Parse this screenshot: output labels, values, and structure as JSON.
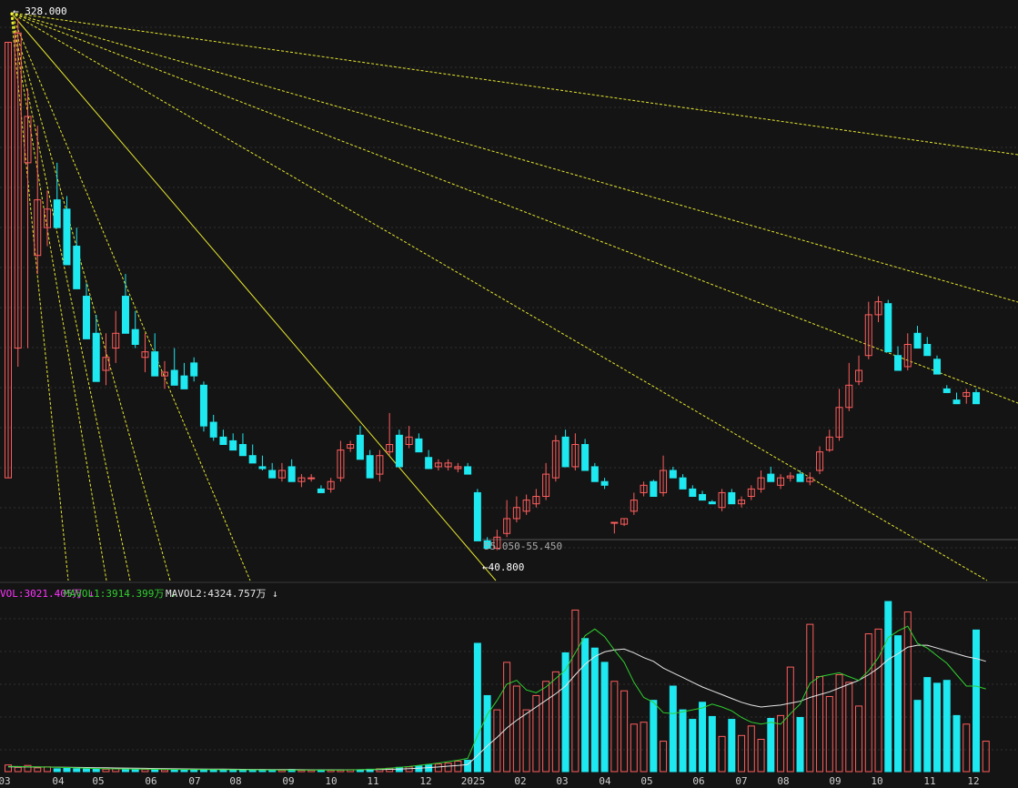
{
  "colors": {
    "background": "#141414",
    "up": "#ff5d5d",
    "down": "#1ee8f0",
    "fan": "#ffff33",
    "mavol1": "#2fd02f",
    "mavol2": "#e6e6e6",
    "vol_label": "#ff33ff",
    "grid": "#2f2f2f"
  },
  "chart_data": [
    {
      "type": "candlestick",
      "title": "",
      "high_label": "328.000",
      "low_label": "40.800",
      "range_label": "55.050-55.450",
      "ylim": [
        40,
        330
      ],
      "grid": true,
      "month_labels": [
        "03",
        "04",
        "05",
        "06",
        "07",
        "08",
        "09",
        "10",
        "11",
        "12",
        "2025",
        "02",
        "03",
        "04",
        "05",
        "06",
        "07",
        "08",
        "09",
        "10",
        "11",
        "12"
      ],
      "candles": [
        [
          80,
          80,
          315,
          315
        ],
        [
          150,
          140,
          320,
          328
        ],
        [
          250,
          150,
          275,
          290
        ],
        [
          200,
          190,
          230,
          270
        ],
        [
          215,
          205,
          225,
          235
        ],
        [
          230,
          220,
          215,
          250
        ],
        [
          225,
          215,
          195,
          232
        ],
        [
          205,
          195,
          182,
          215
        ],
        [
          178,
          168,
          155,
          185
        ],
        [
          158,
          140,
          132,
          168
        ],
        [
          138,
          130,
          145,
          158
        ],
        [
          150,
          142,
          158,
          170
        ],
        [
          178,
          168,
          158,
          190
        ],
        [
          160,
          150,
          152,
          170
        ],
        [
          145,
          137,
          148,
          158
        ],
        [
          148,
          140,
          135,
          158
        ],
        [
          135,
          128,
          137,
          143
        ],
        [
          138,
          132,
          130,
          150
        ],
        [
          135,
          128,
          128,
          142
        ],
        [
          142,
          132,
          135,
          145
        ],
        [
          130,
          105,
          108,
          132
        ],
        [
          110,
          100,
          102,
          114
        ],
        [
          102,
          98,
          98,
          106
        ],
        [
          100,
          96,
          95,
          104
        ],
        [
          98,
          94,
          92,
          104
        ],
        [
          92,
          90,
          88,
          98
        ],
        [
          86,
          84,
          85,
          92
        ],
        [
          84,
          84,
          80,
          88
        ],
        [
          80,
          78,
          84,
          88
        ],
        [
          86,
          84,
          78,
          90
        ],
        [
          78,
          75,
          80,
          82
        ],
        [
          80,
          78,
          80,
          82
        ],
        [
          74,
          72,
          72,
          76
        ],
        [
          74,
          72,
          78,
          80
        ],
        [
          80,
          78,
          95,
          100
        ],
        [
          96,
          94,
          98,
          100
        ],
        [
          103,
          100,
          90,
          108
        ],
        [
          92,
          88,
          80,
          95
        ],
        [
          82,
          78,
          92,
          95
        ],
        [
          94,
          92,
          98,
          115
        ],
        [
          103,
          100,
          86,
          106
        ],
        [
          98,
          96,
          102,
          108
        ],
        [
          101,
          98,
          94,
          104
        ],
        [
          91,
          88,
          85,
          95
        ],
        [
          86,
          84,
          88,
          90
        ],
        [
          86,
          84,
          88,
          90
        ],
        [
          85,
          83,
          86,
          88
        ],
        [
          86,
          84,
          82,
          88
        ],
        [
          72,
          70,
          46,
          74
        ],
        [
          46,
          44,
          42,
          48
        ],
        [
          42,
          41,
          48,
          52
        ],
        [
          50,
          48,
          58,
          68
        ],
        [
          58,
          56,
          64,
          70
        ],
        [
          62,
          60,
          68,
          71
        ],
        [
          66,
          64,
          70,
          74
        ],
        [
          70,
          68,
          82,
          88
        ],
        [
          80,
          78,
          100,
          103
        ],
        [
          102,
          100,
          86,
          106
        ],
        [
          86,
          84,
          98,
          104
        ],
        [
          98,
          96,
          84,
          101
        ],
        [
          86,
          84,
          78,
          88
        ],
        [
          78,
          74,
          76,
          80
        ],
        [
          56,
          50,
          56,
          56
        ],
        [
          55,
          54,
          58,
          58
        ],
        [
          62,
          60,
          68,
          72
        ],
        [
          72,
          70,
          76,
          78
        ],
        [
          78,
          76,
          70,
          79
        ],
        [
          72,
          70,
          84,
          92
        ],
        [
          84,
          82,
          80,
          86
        ],
        [
          80,
          78,
          74,
          82
        ],
        [
          74,
          72,
          70,
          76
        ],
        [
          71,
          70,
          68,
          73
        ],
        [
          67,
          66,
          66,
          68
        ],
        [
          64,
          62,
          72,
          74
        ],
        [
          72,
          70,
          66,
          74
        ],
        [
          66,
          64,
          68,
          70
        ],
        [
          70,
          68,
          74,
          76
        ],
        [
          74,
          72,
          80,
          84
        ],
        [
          82,
          80,
          78,
          86
        ],
        [
          76,
          74,
          80,
          82
        ],
        [
          80,
          78,
          81,
          83
        ],
        [
          82,
          80,
          78,
          84
        ],
        [
          78,
          76,
          80,
          83
        ],
        [
          84,
          82,
          94,
          97
        ],
        [
          95,
          94,
          102,
          106
        ],
        [
          102,
          100,
          118,
          128
        ],
        [
          118,
          116,
          130,
          142
        ],
        [
          132,
          130,
          138,
          146
        ],
        [
          146,
          144,
          168,
          175
        ],
        [
          168,
          164,
          175,
          178
        ],
        [
          174,
          170,
          148,
          176
        ],
        [
          146,
          144,
          138,
          151
        ],
        [
          140,
          138,
          152,
          158
        ],
        [
          158,
          155,
          150,
          162
        ],
        [
          152,
          148,
          146,
          156
        ],
        [
          144,
          140,
          136,
          146
        ],
        [
          128,
          126,
          126,
          130
        ],
        [
          122,
          120,
          120,
          126
        ],
        [
          124,
          120,
          126,
          128
        ],
        [
          126,
          124,
          120,
          128
        ]
      ]
    },
    {
      "type": "bar",
      "title": "",
      "vol_label": "VOL:3021.405万 ↓",
      "mavol1_label": "MAVOL1:3914.399万 ↓",
      "mavol2_label": "MAVOL2:4324.757万 ↓",
      "ylim": [
        0,
        18000
      ],
      "series": [
        {
          "name": "VOL",
          "values": [
            700,
            450,
            650,
            400,
            500,
            300,
            350,
            300,
            280,
            300,
            250,
            280,
            260,
            240,
            230,
            260,
            200,
            230,
            220,
            210,
            250,
            200,
            180,
            170,
            160,
            170,
            150,
            160,
            150,
            220,
            140,
            150,
            140,
            150,
            160,
            200,
            180,
            250,
            300,
            350,
            450,
            500,
            600,
            700,
            800,
            900,
            1100,
            1200,
            13500,
            8000,
            6500,
            11500,
            9000,
            6500,
            8000,
            9500,
            10500,
            12500,
            17000,
            14000,
            13000,
            11500,
            9500,
            8500,
            5000,
            5200,
            7500,
            3200,
            9000,
            6500,
            5500,
            7300,
            5800,
            3700,
            5500,
            3800,
            4800,
            3400,
            5600,
            5900,
            11000,
            5700,
            15500,
            10000,
            7900,
            10200,
            9400,
            6900,
            14500,
            15000,
            17900,
            14300,
            16800,
            7500,
            9900,
            9300,
            9600,
            5900,
            5000,
            14900,
            3200
          ]
        },
        {
          "name": "MAVOL1",
          "values": [
            550,
            540,
            520,
            500,
            480,
            460,
            430,
            390,
            360,
            330,
            300,
            290,
            280,
            270,
            260,
            250,
            240,
            230,
            225,
            220,
            215,
            210,
            205,
            200,
            195,
            190,
            185,
            180,
            175,
            170,
            165,
            160,
            160,
            165,
            170,
            180,
            200,
            230,
            280,
            350,
            440,
            540,
            660,
            780,
            900,
            1050,
            1200,
            1400,
            3800,
            6000,
            7500,
            9200,
            9600,
            8600,
            8300,
            8900,
            9800,
            10700,
            12500,
            14300,
            15000,
            14200,
            12800,
            11500,
            9400,
            7800,
            7300,
            6200,
            6100,
            6300,
            6500,
            6700,
            7100,
            6800,
            6400,
            5700,
            5200,
            5000,
            5200,
            5000,
            6100,
            7100,
            9300,
            10000,
            10200,
            10400,
            10000,
            9600,
            10600,
            12000,
            14100,
            14800,
            15300,
            13500,
            13000,
            12200,
            11400,
            10200,
            9000,
            9000,
            8700
          ]
        },
        {
          "name": "MAVOL2",
          "values": [
            500,
            495,
            490,
            485,
            480,
            470,
            460,
            445,
            430,
            415,
            400,
            385,
            370,
            355,
            340,
            325,
            310,
            300,
            290,
            280,
            270,
            262,
            255,
            248,
            241,
            234,
            227,
            220,
            213,
            206,
            200,
            195,
            190,
            190,
            192,
            195,
            200,
            208,
            220,
            240,
            270,
            310,
            360,
            420,
            490,
            570,
            650,
            740,
            1700,
            2700,
            3600,
            4600,
            5400,
            6100,
            6800,
            7500,
            8200,
            9000,
            10200,
            11300,
            12100,
            12600,
            12800,
            12900,
            12500,
            12000,
            11600,
            10900,
            10400,
            9900,
            9400,
            8900,
            8500,
            8100,
            7700,
            7300,
            7000,
            6800,
            6900,
            7000,
            7200,
            7400,
            7800,
            8100,
            8400,
            8800,
            9200,
            9600,
            10200,
            10900,
            11800,
            12400,
            13100,
            13300,
            13300,
            13000,
            12700,
            12400,
            12100,
            11900,
            11600
          ]
        }
      ]
    }
  ]
}
